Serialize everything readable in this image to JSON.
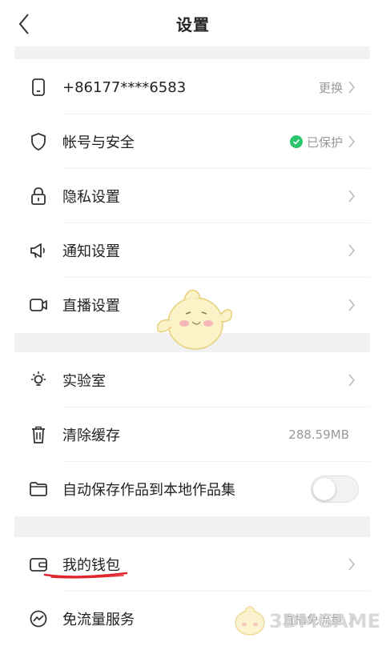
{
  "header": {
    "title": "设置"
  },
  "rows": [
    {
      "label": "+86177****6583",
      "value": "更换",
      "icon": "phone-icon"
    },
    {
      "label": "帐号与安全",
      "value": "已保护",
      "icon": "shield-icon"
    },
    {
      "label": "隐私设置",
      "value": "",
      "icon": "lock-icon"
    },
    {
      "label": "通知设置",
      "value": "",
      "icon": "speaker-icon"
    },
    {
      "label": "直播设置",
      "value": "",
      "icon": "video-camera-icon"
    },
    {
      "label": "实验室",
      "value": "",
      "icon": "lightbulb-icon"
    },
    {
      "label": "清除缓存",
      "value": "288.59MB",
      "icon": "trash-icon"
    },
    {
      "label": "自动保存作品到本地作品集",
      "value": "",
      "icon": "folder-icon",
      "toggle": false
    },
    {
      "label": "我的钱包",
      "value": "",
      "icon": "wallet-icon"
    },
    {
      "label": "免流量服务",
      "value": "直播免流量",
      "icon": "trend-icon"
    }
  ],
  "watermark": {
    "text": "3DMGAME"
  },
  "colors": {
    "accent_green": "#2bc56b",
    "underline_red": "#e0242b",
    "section_gray": "#f1f1f1"
  }
}
